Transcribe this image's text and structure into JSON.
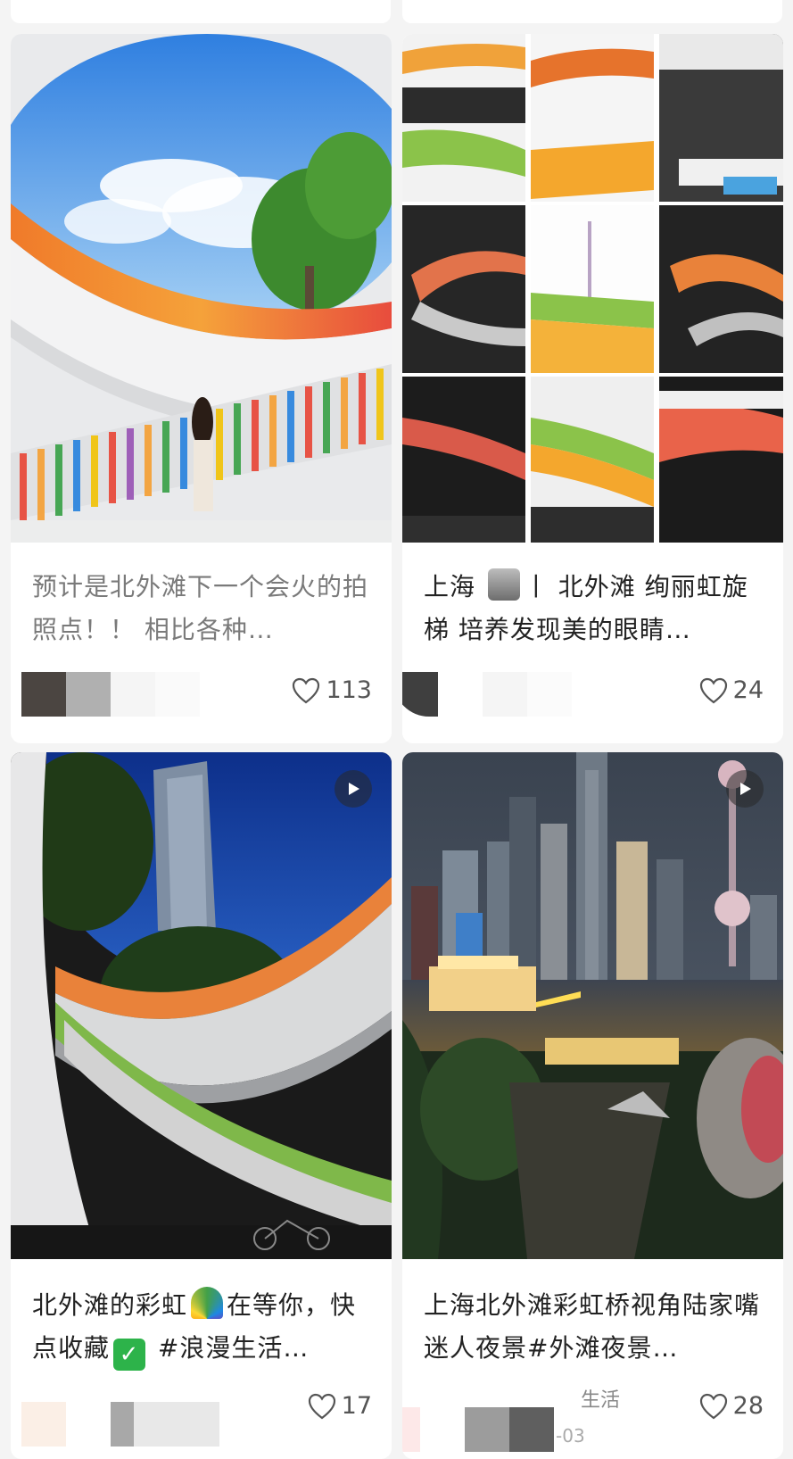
{
  "posts": [
    {
      "title": "预计是北外滩下一个会火的拍照点！！ 相比各种…",
      "likes": "113",
      "is_video": false,
      "heart_icon": "heart-outline-icon"
    },
    {
      "title_before_emoji": "上海 ",
      "title_after_emoji": "丨 北外滩 绚丽虹旋梯 培养发现美的眼睛…",
      "emoji": "camera-flash-emoji",
      "likes": "24",
      "is_video": false,
      "heart_icon": "heart-outline-icon"
    },
    {
      "title_before_emoji": "北外滩的彩虹",
      "title_middle": "在等你，快点收藏",
      "title_after_emoji": " #浪漫生活…",
      "emojis": [
        "rainbow-emoji",
        "check-mark-emoji"
      ],
      "likes": "17",
      "is_video": true,
      "play_icon": "play-icon",
      "heart_icon": "heart-outline-icon"
    },
    {
      "title": "上海北外滩彩虹桥视角陆家嘴迷人夜景#外滩夜景…",
      "author_suffix": "生活",
      "date_suffix": "-03",
      "likes": "28",
      "is_video": true,
      "play_icon": "play-icon",
      "heart_icon": "heart-outline-icon"
    }
  ],
  "colors": {
    "background": "#f4f4f4",
    "card": "#ffffff",
    "text": "#222222",
    "muted_text": "#7a7a7a"
  }
}
